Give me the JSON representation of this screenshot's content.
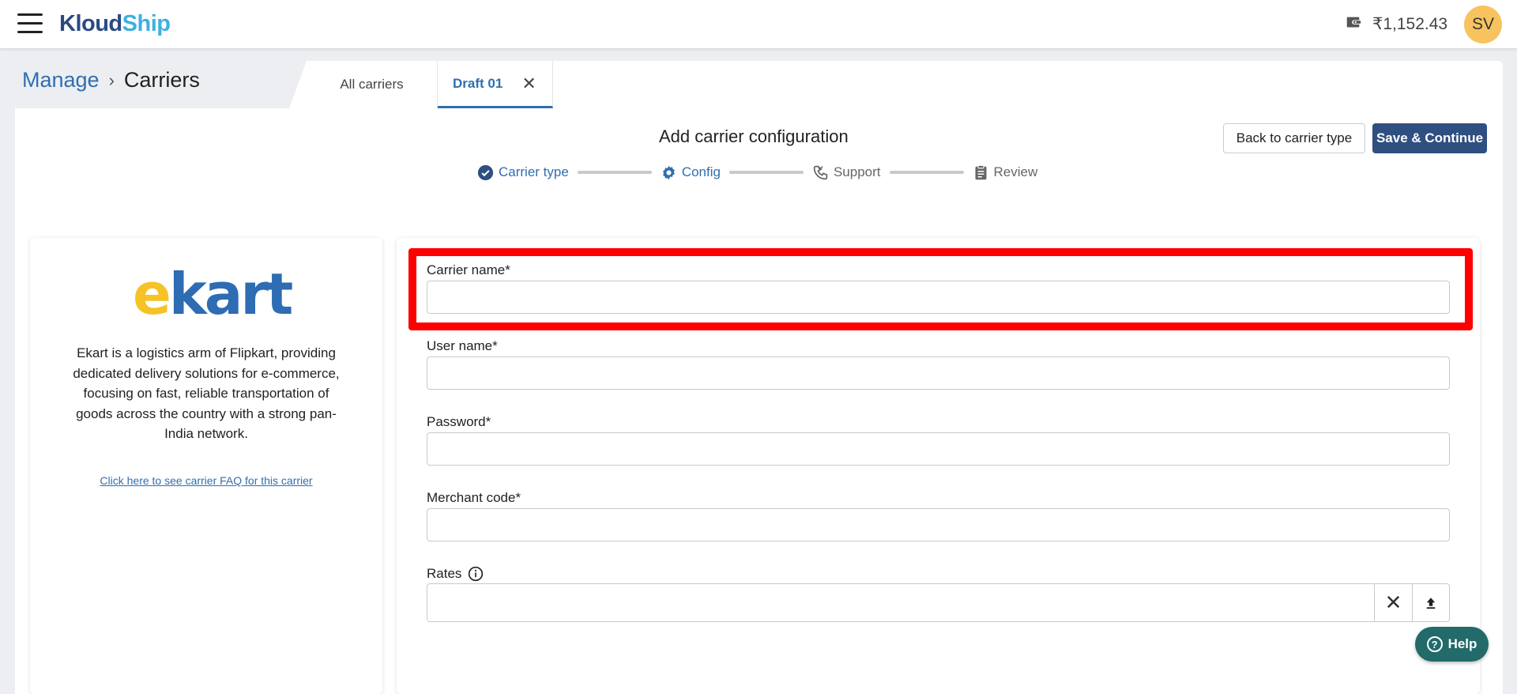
{
  "header": {
    "logo_part1": "Kloud",
    "logo_part2": "Ship",
    "balance": "₹1,152.43",
    "avatar_initials": "SV",
    "icons": [
      "menu-icon",
      "wallet-icon"
    ]
  },
  "breadcrumb": {
    "root": "Manage",
    "separator": "›",
    "current": "Carriers"
  },
  "tabs": [
    {
      "label": "All carriers",
      "active": false
    },
    {
      "label": "Draft 01",
      "active": true,
      "close": "✕"
    }
  ],
  "page": {
    "title": "Add carrier configuration",
    "back_button": "Back to carrier type",
    "save_button": "Save & Continue"
  },
  "stepper": [
    {
      "label": "Carrier type",
      "icon": "check-circle-icon",
      "state": "done"
    },
    {
      "label": "Config",
      "icon": "gear-icon",
      "state": "active"
    },
    {
      "label": "Support",
      "icon": "phone-icon",
      "state": "pending"
    },
    {
      "label": "Review",
      "icon": "clipboard-icon",
      "state": "pending"
    }
  ],
  "carrier": {
    "logo_e": "e",
    "logo_rest": "kart",
    "description": "Ekart is a logistics arm of Flipkart, providing dedicated delivery solutions for e-commerce, focusing on fast, reliable transportation of goods across the country with a strong pan-India network.",
    "faq_link": "Click here to see carrier FAQ for this carrier"
  },
  "form": {
    "carrier_name_label": "Carrier name*",
    "carrier_name_value": "",
    "user_name_label": "User name*",
    "user_name_value": "",
    "password_label": "Password*",
    "password_value": "",
    "merchant_code_label": "Merchant code*",
    "merchant_code_value": "",
    "rates_label": "Rates",
    "rates_value": ""
  },
  "help_button": "Help",
  "colors": {
    "primary": "#2f4f81",
    "link": "#2f6fb0",
    "highlight": "#ff0000",
    "help": "#236a6a",
    "avatar": "#f7c35e"
  }
}
